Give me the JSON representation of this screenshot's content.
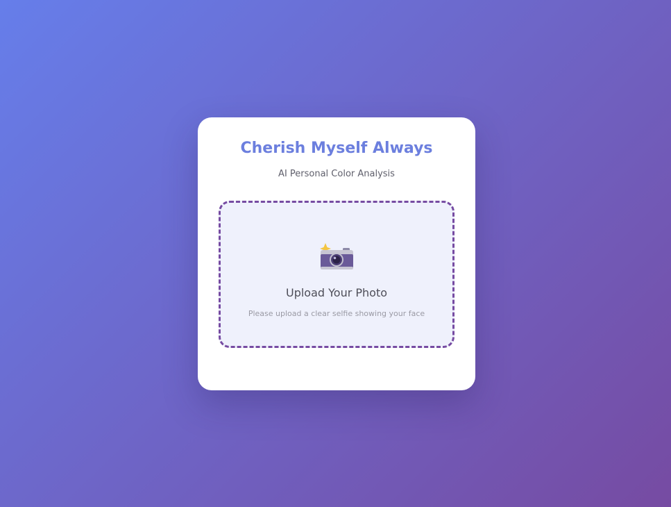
{
  "app": {
    "title": "Cherish Myself Always",
    "subtitle": "AI Personal Color Analysis"
  },
  "upload": {
    "icon": "camera-with-flash-icon",
    "title": "Upload Your Photo",
    "hint": "Please upload a clear selfie showing your face"
  },
  "colors": {
    "background_gradient_start": "#667eea",
    "background_gradient_end": "#764ba2",
    "title": "#6c7fde",
    "upload_border": "#764ba2",
    "upload_background": "#eff1fc"
  }
}
